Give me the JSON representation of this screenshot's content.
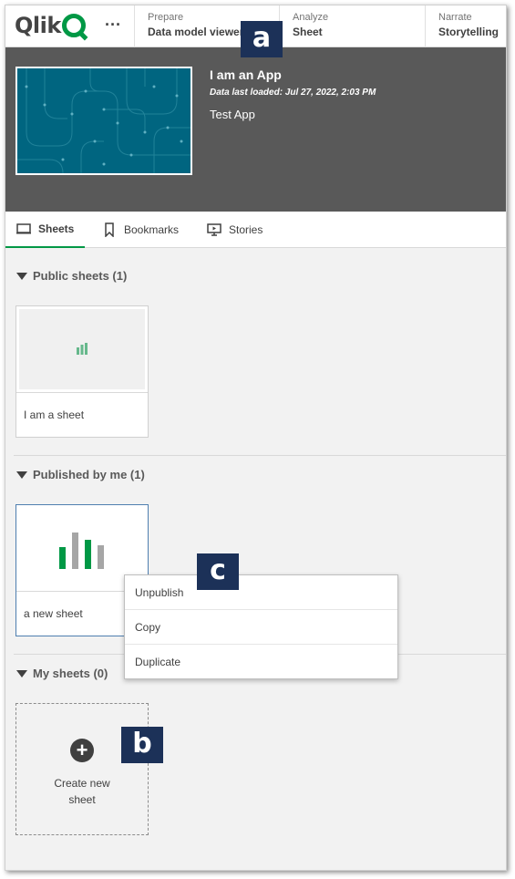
{
  "topbar": {
    "logo_text": "Qlik",
    "more_label": "···",
    "nav": [
      {
        "label": "Prepare",
        "value": "Data model viewer"
      },
      {
        "label": "Analyze",
        "value": "Sheet"
      },
      {
        "label": "Narrate",
        "value": "Storytelling"
      }
    ]
  },
  "app": {
    "title": "I am an App",
    "reload": "Data last loaded: Jul 27, 2022, 2:03 PM",
    "description": "Test App"
  },
  "tabs": [
    {
      "label": "Sheets",
      "icon": "sheet-icon",
      "active": true
    },
    {
      "label": "Bookmarks",
      "icon": "bookmark-icon",
      "active": false
    },
    {
      "label": "Stories",
      "icon": "story-icon",
      "active": false
    }
  ],
  "sections": {
    "public": {
      "title": "Public sheets (1)",
      "sheets": [
        {
          "label": "I am a sheet"
        }
      ]
    },
    "published": {
      "title": "Published by me (1)",
      "sheets": [
        {
          "label": "a new sheet"
        }
      ]
    },
    "mine": {
      "title": "My sheets (0)",
      "create_label": "Create new sheet"
    }
  },
  "context_menu": {
    "items": [
      "Unpublish",
      "Copy",
      "Duplicate"
    ]
  },
  "callouts": {
    "a": "a",
    "b": "b",
    "c": "c"
  },
  "colors": {
    "accent": "#009845",
    "header_bg": "#595959",
    "thumb_bg": "#006580",
    "callout_bg": "#1c3158",
    "bar_grey": "#a6a6a6"
  }
}
